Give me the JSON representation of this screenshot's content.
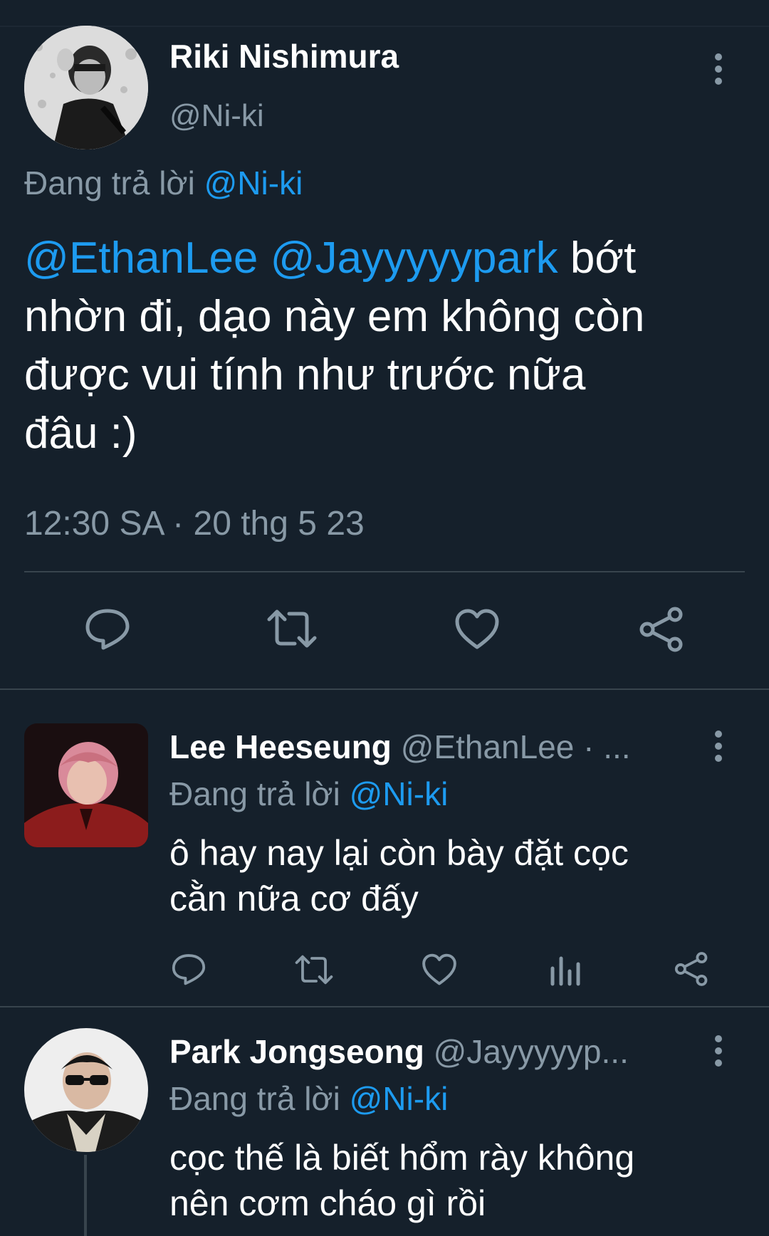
{
  "main_tweet": {
    "name": "Riki Nishimura",
    "handle": "@Ni-ki",
    "replying_prefix": "Đang trả lời",
    "replying_to": "@Ni-ki",
    "mention1": "@EthanLee",
    "mention2": "@Jayyyyypark",
    "text_line1_rest": "bớt",
    "text_line2": "nhờn đi, dạo này em không còn",
    "text_line3": "được vui tính như trước nữa",
    "text_line4": "đâu :)",
    "timestamp": "12:30 SA · 20 thg 5 23",
    "actions": [
      "reply-icon",
      "retweet-icon",
      "like-icon",
      "share-icon"
    ]
  },
  "replies": [
    {
      "name": "Lee Heeseung",
      "handle_trunc": "@EthanLee · ...",
      "replying_prefix": "Đang trả lời",
      "replying_to": "@Ni-ki",
      "text_line1": "ô hay nay lại còn bày đặt cọc",
      "text_line2": "cằn nữa cơ đấy",
      "actions": [
        "reply-icon",
        "retweet-icon",
        "like-icon",
        "analytics-icon",
        "share-icon"
      ]
    },
    {
      "name": "Park Jongseong",
      "handle_trunc": "@Jayyyyyp...",
      "replying_prefix": "Đang trả lời",
      "replying_to": "@Ni-ki",
      "text_line1": "cọc thế là biết hổm rày không",
      "text_line2": "nên cơm cháo gì rồi"
    }
  ],
  "colors": {
    "background": "#15202b",
    "accent": "#1d9bf0",
    "secondary_text": "#8899a6",
    "divider": "#38444d"
  }
}
